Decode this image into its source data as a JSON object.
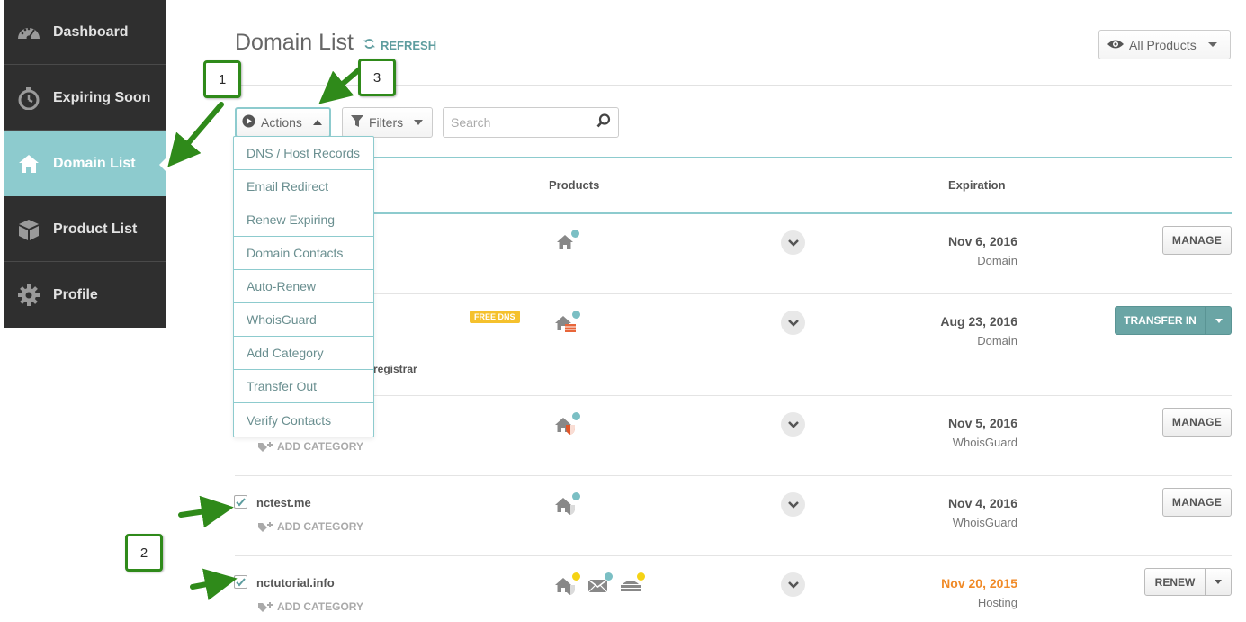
{
  "sidebar": {
    "items": [
      {
        "label": "Dashboard",
        "icon": "speedometer-icon"
      },
      {
        "label": "Expiring Soon",
        "icon": "stopwatch-icon"
      },
      {
        "label": "Domain List",
        "icon": "home-icon",
        "active": true
      },
      {
        "label": "Product List",
        "icon": "box-icon"
      },
      {
        "label": "Profile",
        "icon": "gear-icon"
      }
    ]
  },
  "header": {
    "title": "Domain List",
    "refresh_label": "REFRESH",
    "filter_select_label": "All Products"
  },
  "toolbar": {
    "actions_label": "Actions",
    "filters_label": "Filters",
    "search_placeholder": "Search"
  },
  "actions_menu": {
    "items": [
      "DNS / Host Records",
      "Email Redirect",
      "Renew Expiring",
      "Domain Contacts",
      "Auto-Renew",
      "WhoisGuard",
      "Add Category",
      "Transfer Out",
      "Verify Contacts"
    ]
  },
  "table": {
    "columns": {
      "products": "Products",
      "expiration": "Expiration"
    },
    "rows": [
      {
        "domain": "",
        "date": "Nov 6, 2016",
        "type": "Domain",
        "action": "MANAGE",
        "product_dots": [
          "#7bbfc4"
        ]
      },
      {
        "domain": "",
        "badge": "FREE DNS",
        "note": "registrar",
        "date": "Aug 23, 2016",
        "type": "Domain",
        "action": "TRANSFER IN",
        "product_dots": [
          "#7bbfc4"
        ]
      },
      {
        "domain": "",
        "add_category": "ADD CATEGORY",
        "date": "Nov 5, 2016",
        "type": "WhoisGuard",
        "action": "MANAGE",
        "product_dots": [
          "#7bbfc4"
        ]
      },
      {
        "domain": "nctest.me",
        "checked": true,
        "add_category": "ADD CATEGORY",
        "date": "Nov 4, 2016",
        "type": "WhoisGuard",
        "action": "MANAGE",
        "product_dots": [
          "#7bbfc4"
        ]
      },
      {
        "domain": "nctutorial.info",
        "checked": true,
        "add_category": "ADD CATEGORY",
        "date": "Nov 20, 2015",
        "date_color": "#f08a27",
        "type": "Hosting",
        "action": "RENEW",
        "product_dots": [
          "#f5d315",
          "#7bbfc4",
          "#f5d315"
        ]
      }
    ]
  },
  "annotations": {
    "callouts": [
      "1",
      "2",
      "3"
    ],
    "color": "#2f8a1a"
  }
}
